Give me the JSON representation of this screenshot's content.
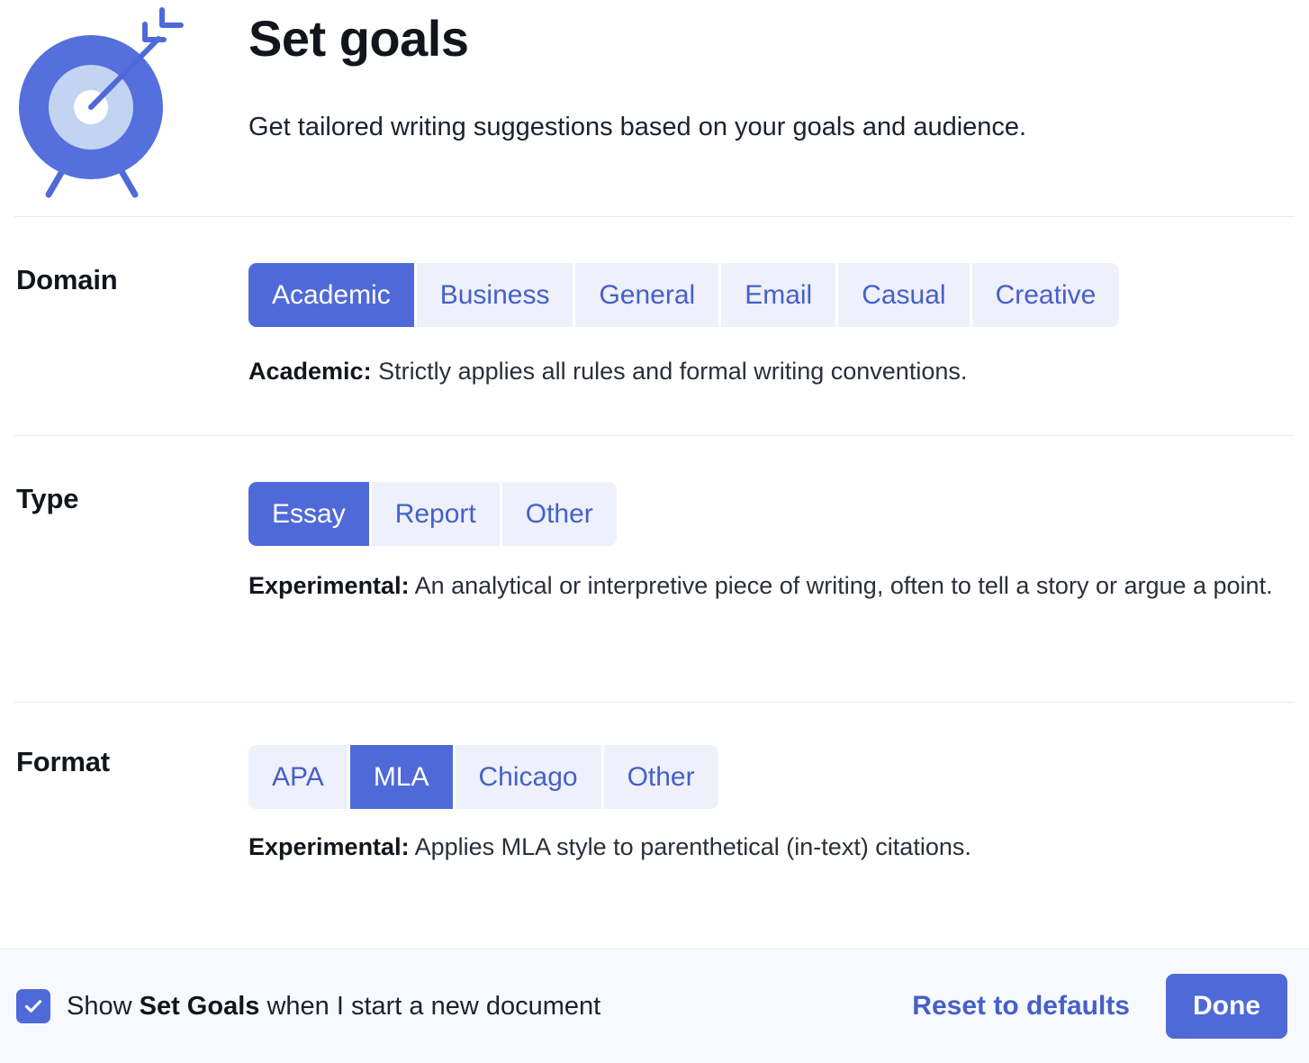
{
  "header": {
    "icon": "target-bullseye-arrow-icon",
    "title": "Set goals",
    "subtitle": "Get tailored writing suggestions based on your goals and audience."
  },
  "sections": [
    {
      "key": "domain",
      "label": "Domain",
      "options": [
        "Academic",
        "Business",
        "General",
        "Email",
        "Casual",
        "Creative"
      ],
      "selected": "Academic",
      "description_lead": "Academic:",
      "description_rest": " Strictly applies all rules and formal writing conventions."
    },
    {
      "key": "type",
      "label": "Type",
      "options": [
        "Essay",
        "Report",
        "Other"
      ],
      "selected": "Essay",
      "description_lead": "Experimental:",
      "description_rest": " An analytical or interpretive piece of writing, often to tell a story or argue a point."
    },
    {
      "key": "format",
      "label": "Format",
      "options": [
        "APA",
        "MLA",
        "Chicago",
        "Other"
      ],
      "selected": "MLA",
      "description_lead": "Experimental:",
      "description_rest": " Applies MLA style to parenthetical (in-text) citations."
    }
  ],
  "footer": {
    "checkbox_checked": true,
    "checkbox_icon": "check-icon",
    "label_pre": "Show ",
    "label_bold": "Set Goals",
    "label_post": " when I start a new document",
    "reset_label": "Reset to defaults",
    "done_label": "Done"
  },
  "colors": {
    "accent": "#4f6ad8",
    "accent_text": "#4560c8",
    "chip_bg": "#eef0fb",
    "footer_bg": "#f8f9ff",
    "divider": "#e8e9f0",
    "title": "#13151d"
  }
}
